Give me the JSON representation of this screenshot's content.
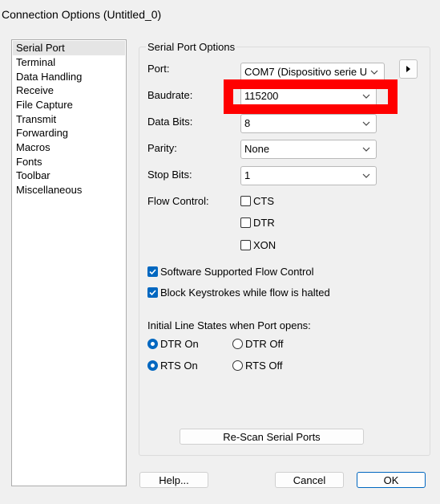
{
  "window": {
    "title": "Connection Options (Untitled_0)"
  },
  "sidebar": {
    "items": [
      {
        "label": "Serial Port",
        "selected": true
      },
      {
        "label": "Terminal"
      },
      {
        "label": "Data Handling"
      },
      {
        "label": "Receive"
      },
      {
        "label": "File Capture"
      },
      {
        "label": "Transmit"
      },
      {
        "label": "Forwarding"
      },
      {
        "label": "Macros"
      },
      {
        "label": "Fonts"
      },
      {
        "label": "Toolbar"
      },
      {
        "label": "Miscellaneous"
      }
    ]
  },
  "options": {
    "group_title": "Serial Port Options",
    "port": {
      "label": "Port:",
      "value": "COM7 (Dispositivo serie U"
    },
    "baudrate": {
      "label": "Baudrate:",
      "value": "115200"
    },
    "data_bits": {
      "label": "Data Bits:",
      "value": "8"
    },
    "parity": {
      "label": "Parity:",
      "value": "None"
    },
    "stop_bits": {
      "label": "Stop Bits:",
      "value": "1"
    },
    "flow_control": {
      "label": "Flow Control:",
      "cts": {
        "label": "CTS",
        "checked": false
      },
      "dtr": {
        "label": "DTR",
        "checked": false
      },
      "xon": {
        "label": "XON",
        "checked": false
      }
    },
    "software_flow": {
      "label": "Software Supported Flow Control",
      "checked": true
    },
    "block_keystrokes": {
      "label": "Block Keystrokes while flow is halted",
      "checked": true
    },
    "initial_states": {
      "label": "Initial Line States when Port opens:",
      "dtr_on": "DTR On",
      "dtr_off": "DTR Off",
      "rts_on": "RTS On",
      "rts_off": "RTS Off",
      "dtr_selected": "on",
      "rts_selected": "on"
    },
    "rescan_label": "Re-Scan Serial Ports"
  },
  "footer": {
    "help_label": "Help...",
    "cancel_label": "Cancel",
    "ok_label": "OK"
  },
  "colors": {
    "accent": "#0067c0",
    "highlight": "#ff0000",
    "background": "#f0f0f0"
  }
}
